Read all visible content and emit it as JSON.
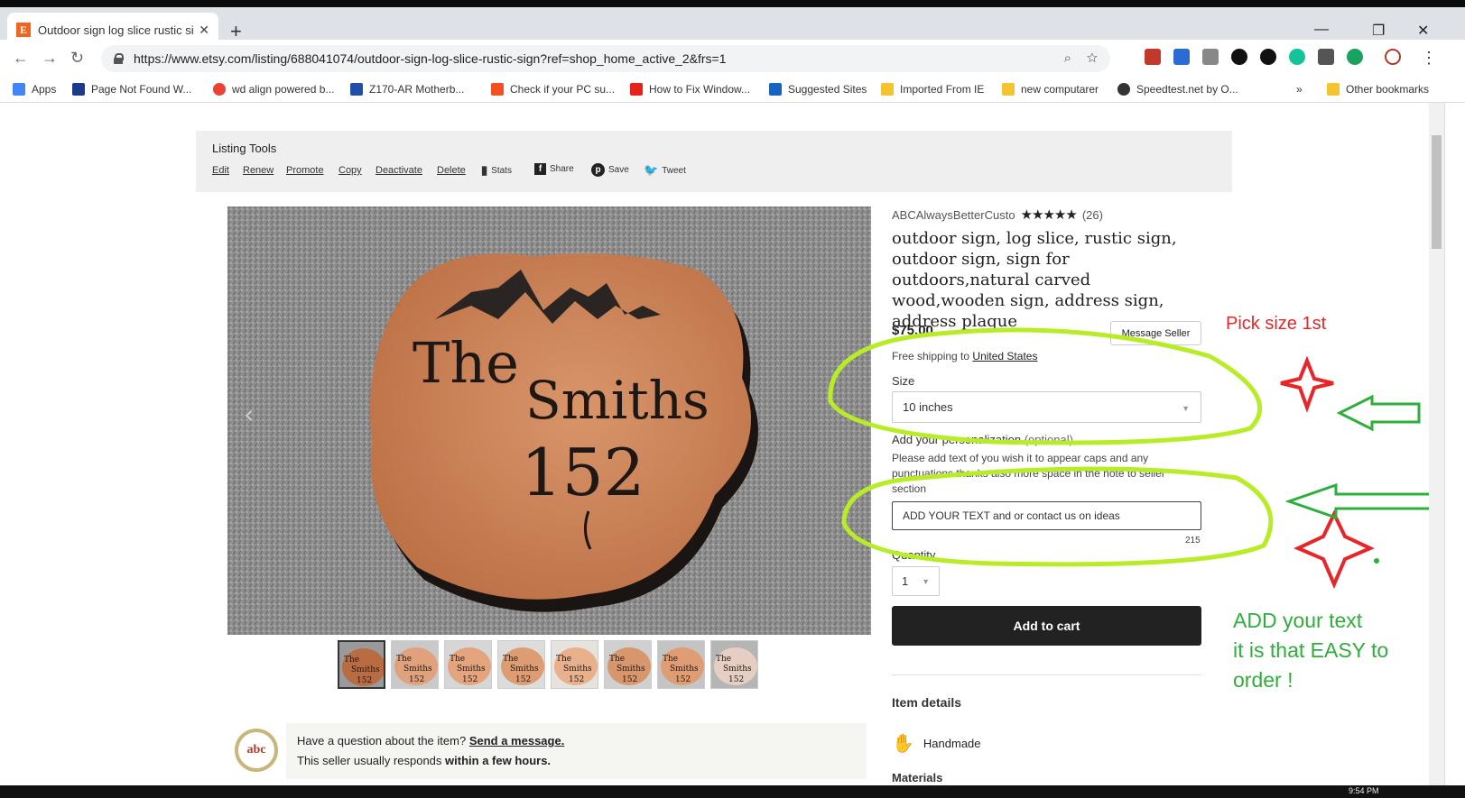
{
  "browser": {
    "tab_title": "Outdoor sign log slice rustic sign",
    "tab_favicon": "E",
    "url": "https://www.etsy.com/listing/688041074/outdoor-sign-log-slice-rustic-sign?ref=shop_home_active_2&frs=1",
    "bookmarks": [
      {
        "label": "Apps",
        "icon": "apps-grid-icon",
        "color": "#4285f4"
      },
      {
        "label": "Page Not Found  W...",
        "icon": "wd-icon",
        "color": "#1a3a8a"
      },
      {
        "label": "wd align powered b...",
        "icon": "google-icon",
        "color": "#ea4335"
      },
      {
        "label": "Z170-AR  Motherb...",
        "icon": "asus-icon",
        "color": "#1f4fa8"
      },
      {
        "label": "Check if your PC su...",
        "icon": "windows-icon",
        "color": "#f25022"
      },
      {
        "label": "How to Fix Window...",
        "icon": "youtube-icon",
        "color": "#e62117"
      },
      {
        "label": "Suggested Sites",
        "icon": "bing-icon",
        "color": "#1565c0"
      },
      {
        "label": "Imported From IE",
        "icon": "folder-icon",
        "color": "#f4c430"
      },
      {
        "label": "new computarer",
        "icon": "folder-icon",
        "color": "#f4c430"
      },
      {
        "label": "Speedtest.net by O...",
        "icon": "speedtest-icon",
        "color": "#333333"
      }
    ],
    "bookmarks_more": "»",
    "other_bookmarks": "Other bookmarks",
    "taskbar_time": "9:54 PM"
  },
  "listing_tools": {
    "title": "Listing Tools",
    "links": [
      "Edit",
      "Renew",
      "Promote",
      "Copy",
      "Deactivate",
      "Delete"
    ],
    "stats": "Stats",
    "share": "Share",
    "save": "Save",
    "tweet": "Tweet"
  },
  "hero": {
    "sign_line1": "The",
    "sign_line2": "Smiths",
    "sign_line3": "152"
  },
  "thumbs": [
    {
      "line1": "The",
      "line2": "Smiths",
      "line3": "152",
      "selected": true
    },
    {
      "line1": "The",
      "line2": "Smiths",
      "line3": "152",
      "selected": false
    },
    {
      "line1": "The",
      "line2": "Smiths",
      "line3": "152",
      "selected": false
    },
    {
      "line1": "The",
      "line2": "Smiths",
      "line3": "152",
      "selected": false
    },
    {
      "line1": "The",
      "line2": "Smiths",
      "line3": "152",
      "selected": false
    },
    {
      "line1": "The",
      "line2": "Smiths",
      "line3": "152",
      "selected": false
    },
    {
      "line1": "The",
      "line2": "Smiths",
      "line3": "152",
      "selected": false
    },
    {
      "line1": "The",
      "line2": "Smiths",
      "line3": "152",
      "selected": false
    }
  ],
  "question": {
    "prefix": "Have a question about the item?",
    "link": "Send a message.",
    "line2_prefix": "This seller usually responds",
    "line2_bold": "within a few hours.",
    "avatar_text": "abc"
  },
  "product": {
    "seller": "ABCAlwaysBetterCusto",
    "stars": "★★★★★",
    "reviews": "(26)",
    "title": "outdoor sign, log slice, rustic sign, outdoor sign, sign for outdoors,natural carved wood,wooden sign, address sign, address plaque",
    "price": "$75.00",
    "message_seller": "Message Seller",
    "shipping_prefix": "Free shipping to",
    "shipping_country": "United States",
    "size_label": "Size",
    "size_value": "10 inches",
    "personalization_label": "Add your personalization",
    "personalization_optional": "(optional)",
    "personalization_instructions": "Please add text of you wish it to appear caps and any punctuations thanks also more space in the note to seller section",
    "personalization_value": "ADD YOUR TEXT and or contact us on ideas",
    "char_count": "215",
    "quantity_label": "Quantity",
    "quantity_value": "1",
    "add_to_cart": "Add to cart",
    "item_details": "Item details",
    "handmade": "Handmade",
    "materials": "Materials"
  },
  "annotations": {
    "pick_size": "Pick size 1st",
    "add_text_line1": "ADD your text",
    "add_text_line2": "it is that EASY to",
    "add_text_line3": "order !",
    "red_color": "#e8262a",
    "green_color": "#2fae3c",
    "lime_color": "#b7ec26"
  }
}
